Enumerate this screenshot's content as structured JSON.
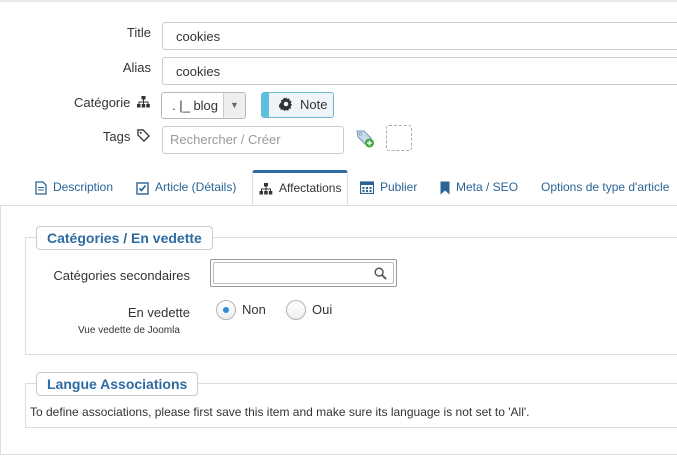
{
  "form": {
    "title_label": "Title",
    "title_value": "cookies",
    "alias_label": "Alias",
    "alias_value": "cookies",
    "category_label": "Catégorie",
    "category_value": ". |_ blog",
    "note_label": "Note",
    "tags_label": "Tags",
    "tags_placeholder": "Rechercher / Créer"
  },
  "tabs": [
    {
      "label": "Description",
      "icon": "file-text-icon"
    },
    {
      "label": "Article (Détails)",
      "icon": "checkbox-icon"
    },
    {
      "label": "Affectations",
      "icon": "sitemap-icon",
      "active": true
    },
    {
      "label": "Publier",
      "icon": "calendar-icon"
    },
    {
      "label": "Meta / SEO",
      "icon": "bookmark-icon"
    },
    {
      "label": "Options de type d'article",
      "icon": ""
    }
  ],
  "categories_section": {
    "legend": "Catégories / En vedette",
    "secondary_label": "Catégories secondaires",
    "featured_label": "En vedette",
    "featured_note": "Vue vedette de Joomla",
    "option_no": "Non",
    "option_yes": "Oui",
    "selected": "Non"
  },
  "language_section": {
    "legend": "Langue Associations",
    "message": "To define associations, please first save this item and make sure its language is not set to 'All'."
  },
  "colors": {
    "accent": "#2d6ca2",
    "link": "#2a6496",
    "note_accent": "#5bc0de"
  }
}
